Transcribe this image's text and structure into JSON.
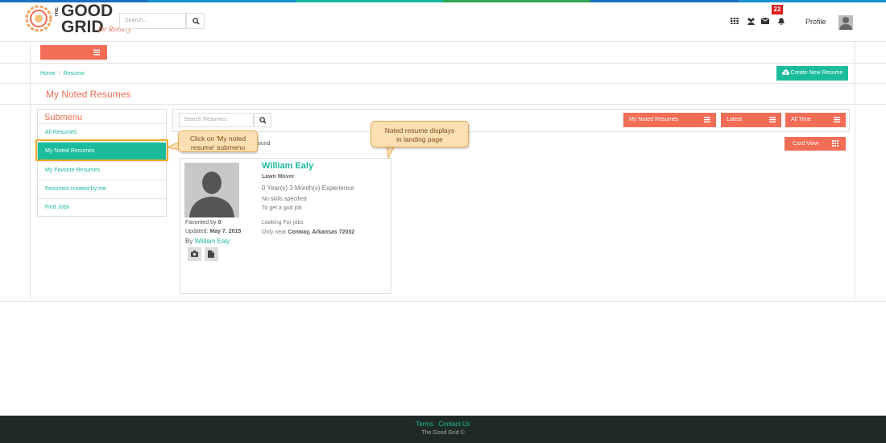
{
  "brand": {
    "logo_top_word": "THE",
    "logo_word_1": "GOOD",
    "logo_word_2": "GRID",
    "logo_tagline": "for Reentry",
    "stripe_colors": [
      "#1a6fbf",
      "#1b8fd1",
      "#1bb89e",
      "#2fa84f",
      "#1a6fbf",
      "#1b8fd1"
    ]
  },
  "header": {
    "search_placeholder": "Search...",
    "icons": [
      "apps-grid-icon",
      "users-icon",
      "envelope-icon",
      "bell-icon"
    ],
    "notification_count": "22",
    "profile_label": "Profile"
  },
  "breadcrumb": {
    "home": "Home",
    "separator": "/",
    "current": "Resume"
  },
  "actions": {
    "create_resume": "Create New Resume"
  },
  "page": {
    "title": "My Noted Resumes"
  },
  "submenu": {
    "title": "Submenu",
    "items": [
      {
        "label": "All Resumes",
        "active": false
      },
      {
        "label": "My Noted Resumes",
        "active": true
      },
      {
        "label": "My Favorite Resumes",
        "active": false
      },
      {
        "label": "Resumes created by me",
        "active": false
      },
      {
        "label": "Find Jobs",
        "active": false
      }
    ]
  },
  "toolbar": {
    "search_placeholder": "Search Resumes",
    "filter_noted": "My Noted Resumes",
    "filter_sort": "Latest",
    "filter_time": "All Time",
    "view_toggle": "Card View"
  },
  "results": {
    "count_text": "ound"
  },
  "resume_card": {
    "name": "William Ealy",
    "role": "Lawn Mover",
    "experience": "0 Year(s) 3 Month(s) Experience",
    "skills": "No skills specified",
    "objective": "To get a gud job",
    "looking_for": "Looking For jobs",
    "location_prefix": "Only near",
    "location": "Conway, Arkansas 72032",
    "favorited_prefix": "Favorited by",
    "favorited_count": "0",
    "updated_prefix": "Updated:",
    "updated_date": "May 7, 2015",
    "by_prefix": "By",
    "author": "William Ealy"
  },
  "callouts": {
    "submenu_hint_line1": "Click on 'My noted",
    "submenu_hint_line2": "resume' submenu",
    "landing_hint_line1": "Noted resume displays",
    "landing_hint_line2": "in landing page"
  },
  "footer": {
    "terms": "Terms",
    "contact": "Contact Us",
    "copyright": "The Good Grid ©"
  },
  "colors": {
    "accent_coral": "#f26d56",
    "accent_teal": "#1bbc9b",
    "callout_fill": "#fbe0b4",
    "footer_bg": "#1f2a27"
  }
}
